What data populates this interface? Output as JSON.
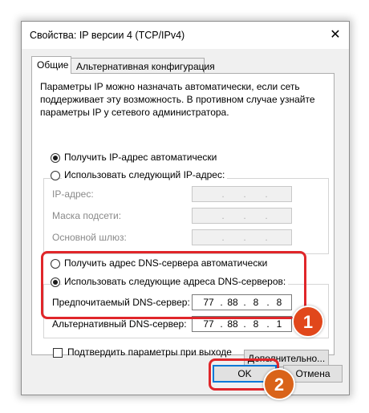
{
  "window": {
    "title": "Свойства: IP версии 4 (TCP/IPv4)",
    "close_glyph": "✕"
  },
  "tabs": [
    {
      "label": "Общие",
      "active": true
    },
    {
      "label": "Альтернативная конфигурация",
      "active": false
    }
  ],
  "description": "Параметры IP можно назначать автоматически, если сеть поддерживает эту возможность. В противном случае узнайте параметры IP у сетевого администратора.",
  "ip_section": {
    "auto_option": "Получить IP-адрес автоматически",
    "manual_option": "Использовать следующий IP-адрес:",
    "selected": "auto",
    "fields": [
      {
        "label": "IP-адрес:",
        "value": ". . ."
      },
      {
        "label": "Маска подсети:",
        "value": ". . ."
      },
      {
        "label": "Основной шлюз:",
        "value": ". . ."
      }
    ]
  },
  "dns_section": {
    "auto_option": "Получить адрес DNS-сервера автоматически",
    "manual_option": "Использовать следующие адреса DNS-серверов:",
    "selected": "manual",
    "preferred": {
      "label": "Предпочитаемый DNS-сервер:",
      "octets": [
        "77",
        "88",
        "8",
        "8"
      ]
    },
    "alternate": {
      "label": "Альтернативный DNS-сервер:",
      "octets": [
        "77",
        "88",
        "8",
        "1"
      ]
    }
  },
  "validate_on_exit": {
    "label": "Подтвердить параметры при выходе",
    "checked": false
  },
  "buttons": {
    "advanced": "Дополнительно...",
    "ok": "OK",
    "cancel": "Отмена"
  },
  "annotations": {
    "badge_1": "1",
    "badge_2": "2",
    "highlight_color": "#e0262a",
    "badge_color": "#e1471b"
  }
}
